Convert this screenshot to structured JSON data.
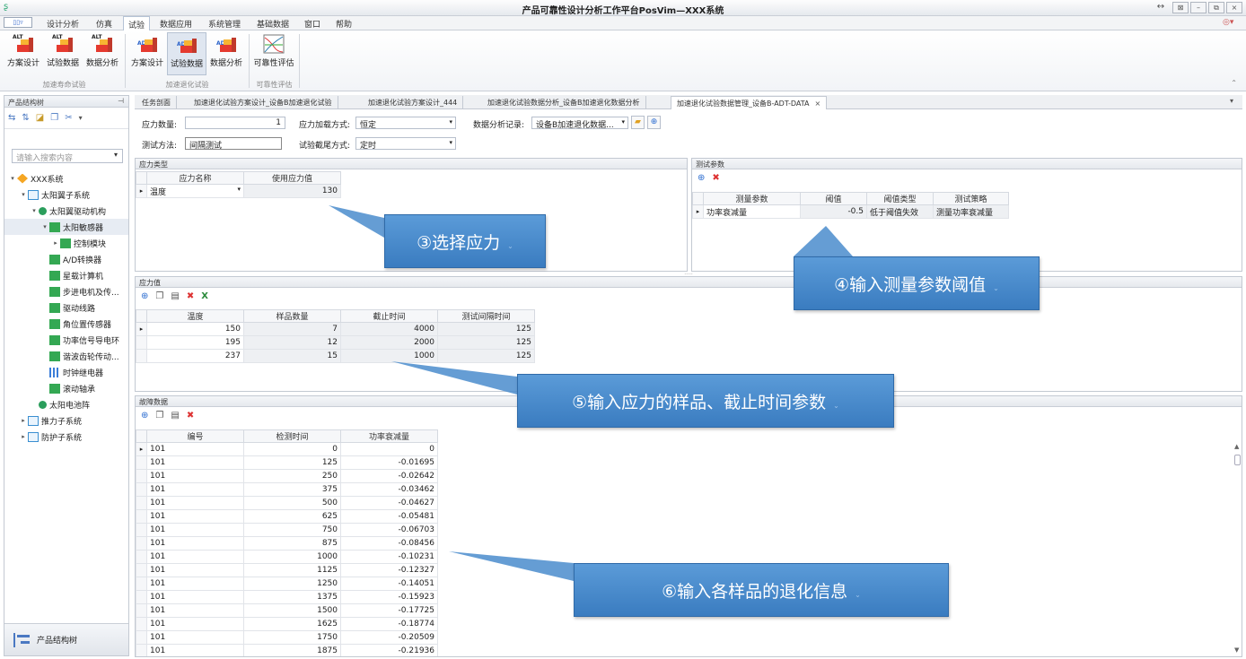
{
  "titlebar": {
    "title": "产品可靠性设计分析工作平台PosVim—XXX系统"
  },
  "menubar": {
    "quick_label": "▯▯▿",
    "items": [
      "设计分析",
      "仿真",
      "试验",
      "数据应用",
      "系统管理",
      "基础数据",
      "窗口",
      "帮助"
    ],
    "active": "试验",
    "right_icon": "◎▾"
  },
  "ribbon": {
    "buttons": [
      {
        "label": "方案设计",
        "tag": "ALT"
      },
      {
        "label": "试验数据",
        "tag": "ALT"
      },
      {
        "label": "数据分析",
        "tag": "ALT"
      },
      {
        "label": "方案设计",
        "tag": "ADT"
      },
      {
        "label": "试验数据",
        "tag": "ADT"
      },
      {
        "label": "数据分析",
        "tag": "ADT"
      },
      {
        "label": "可靠性评估",
        "tag": ""
      }
    ],
    "groups": [
      "加速寿命试验",
      "加速退化试验",
      "可靠性评估"
    ]
  },
  "left_panel": {
    "title": "产品结构树",
    "search_placeholder": "请输入搜索内容",
    "tree": [
      {
        "label": "XXX系统",
        "level": 0,
        "icon": "system-icon",
        "exp": "▾"
      },
      {
        "label": "太阳翼子系统",
        "level": 1,
        "icon": "subsystem-icon",
        "exp": "▾"
      },
      {
        "label": "太阳翼驱动机构",
        "level": 2,
        "icon": "mechanism-icon",
        "exp": "▾"
      },
      {
        "label": "太阳敏感器",
        "level": 3,
        "icon": "part-icon",
        "exp": "▾",
        "selected": true
      },
      {
        "label": "控制模块",
        "level": 4,
        "icon": "part-icon",
        "exp": "▸"
      },
      {
        "label": "A/D转换器",
        "level": 3,
        "icon": "part-icon",
        "exp": ""
      },
      {
        "label": "星载计算机",
        "level": 3,
        "icon": "part-icon",
        "exp": ""
      },
      {
        "label": "步进电机及传...",
        "level": 3,
        "icon": "part-icon",
        "exp": ""
      },
      {
        "label": "驱动线路",
        "level": 3,
        "icon": "part-icon",
        "exp": ""
      },
      {
        "label": "角位置传感器",
        "level": 3,
        "icon": "part-icon",
        "exp": ""
      },
      {
        "label": "功率信号导电环",
        "level": 3,
        "icon": "part-icon",
        "exp": ""
      },
      {
        "label": "谐波齿轮传动...",
        "level": 3,
        "icon": "part-icon",
        "exp": ""
      },
      {
        "label": "时钟继电器",
        "level": 3,
        "icon": "relay-icon",
        "exp": ""
      },
      {
        "label": "滚动轴承",
        "level": 3,
        "icon": "part-icon",
        "exp": ""
      },
      {
        "label": "太阳电池阵",
        "level": 2,
        "icon": "mechanism-icon",
        "exp": ""
      },
      {
        "label": "推力子系统",
        "level": 1,
        "icon": "subsystem-icon",
        "exp": "▸"
      },
      {
        "label": "防护子系统",
        "level": 1,
        "icon": "subsystem-icon",
        "exp": "▸"
      }
    ],
    "footer": "产品结构树"
  },
  "tabs": [
    {
      "label": "任务剖面"
    },
    {
      "label": "加速退化试验方案设计_设备B加速退化试验"
    },
    {
      "label": "加速退化试验方案设计_444"
    },
    {
      "label": "加速退化试验数据分析_设备B加速退化数据分析"
    },
    {
      "label": "加速退化试验数据管理_设备B-ADT-DATA",
      "active": true,
      "close": "×"
    }
  ],
  "form": {
    "stress_count_label": "应力数量:",
    "stress_count": "1",
    "load_mode_label": "应力加载方式:",
    "load_mode": "恒定",
    "analysis_record_label": "数据分析记录:",
    "analysis_record": "设备B加速退化数据...",
    "test_method_label": "测试方法:",
    "test_method": "间隔测试",
    "censor_mode_label": "试验截尾方式:",
    "censor_mode": "定时"
  },
  "stress_type": {
    "title": "应力类型",
    "columns": [
      "应力名称",
      "使用应力值"
    ],
    "rows": [
      [
        "温度",
        "130"
      ]
    ]
  },
  "test_params": {
    "title": "测试参数",
    "columns": [
      "测量参数",
      "阈值",
      "阈值类型",
      "测试策略"
    ],
    "rows": [
      [
        "功率衰减量",
        "-0.5",
        "低于阈值失效",
        "测量功率衰减量"
      ]
    ]
  },
  "stress_values": {
    "title": "应力值",
    "columns": [
      "温度",
      "样品数量",
      "截止时间",
      "测试间隔时间"
    ],
    "rows": [
      [
        "150",
        "7",
        "4000",
        "125"
      ],
      [
        "195",
        "12",
        "2000",
        "125"
      ],
      [
        "237",
        "15",
        "1000",
        "125"
      ]
    ]
  },
  "fault_data": {
    "title": "故障数据",
    "columns": [
      "编号",
      "检测时间",
      "功率衰减量"
    ],
    "rows": [
      [
        "101",
        "0",
        "0"
      ],
      [
        "101",
        "125",
        "-0.01695"
      ],
      [
        "101",
        "250",
        "-0.02642"
      ],
      [
        "101",
        "375",
        "-0.03462"
      ],
      [
        "101",
        "500",
        "-0.04627"
      ],
      [
        "101",
        "625",
        "-0.05481"
      ],
      [
        "101",
        "750",
        "-0.06703"
      ],
      [
        "101",
        "875",
        "-0.08456"
      ],
      [
        "101",
        "1000",
        "-0.10231"
      ],
      [
        "101",
        "1125",
        "-0.12327"
      ],
      [
        "101",
        "1250",
        "-0.14051"
      ],
      [
        "101",
        "1375",
        "-0.15923"
      ],
      [
        "101",
        "1500",
        "-0.17725"
      ],
      [
        "101",
        "1625",
        "-0.18774"
      ],
      [
        "101",
        "1750",
        "-0.20509"
      ],
      [
        "101",
        "1875",
        "-0.21936"
      ]
    ]
  },
  "callouts": {
    "c3": "③选择应力",
    "c4": "④输入测量参数阈值",
    "c5": "⑤输入应力的样品、截止时间参数",
    "c6": "⑥输入各样品的退化信息"
  },
  "colors": {
    "callout": "#4a8ccc",
    "accent": "#2f6fd1"
  }
}
